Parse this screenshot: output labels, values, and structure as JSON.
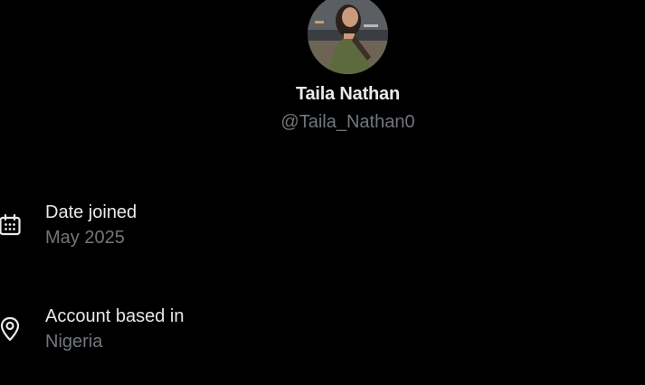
{
  "profile": {
    "display_name": "Taila Nathan",
    "handle": "@Taila_Nathan0",
    "avatar_icon": "profile-photo"
  },
  "about": {
    "date_joined": {
      "icon": "calendar-icon",
      "label": "Date joined",
      "value": "May 2025"
    },
    "account_based_in": {
      "icon": "location-pin-icon",
      "label": "Account based in",
      "value": "Nigeria"
    }
  },
  "colors": {
    "background": "#000000",
    "primary_text": "#e7e9ea",
    "secondary_text": "#71767b"
  }
}
